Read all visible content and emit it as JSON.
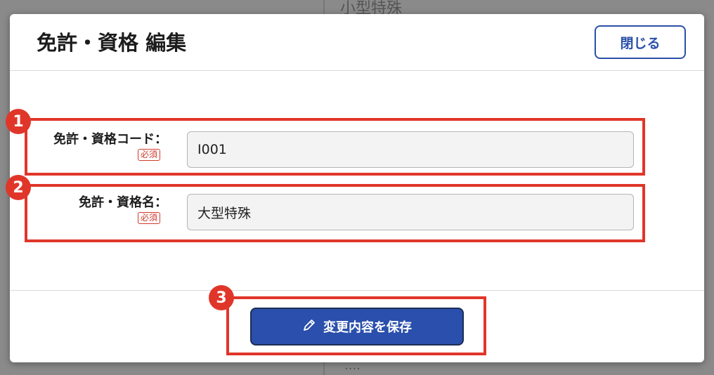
{
  "background": {
    "top_text": "小型特殊",
    "bottom_text": "...."
  },
  "modal": {
    "title": "免許・資格 編集",
    "close_label": "閉じる"
  },
  "fields": [
    {
      "label": "免許・資格コード：",
      "required": "必須",
      "value": "I001"
    },
    {
      "label": "免許・資格名：",
      "required": "必須",
      "value": "大型特殊"
    }
  ],
  "save_button": {
    "label": "変更内容を保存",
    "icon": "pencil-icon"
  },
  "callouts": [
    "1",
    "2",
    "3"
  ],
  "colors": {
    "accent": "#2a4fac",
    "callout": "#e0362a",
    "required": "#d03a2c"
  }
}
